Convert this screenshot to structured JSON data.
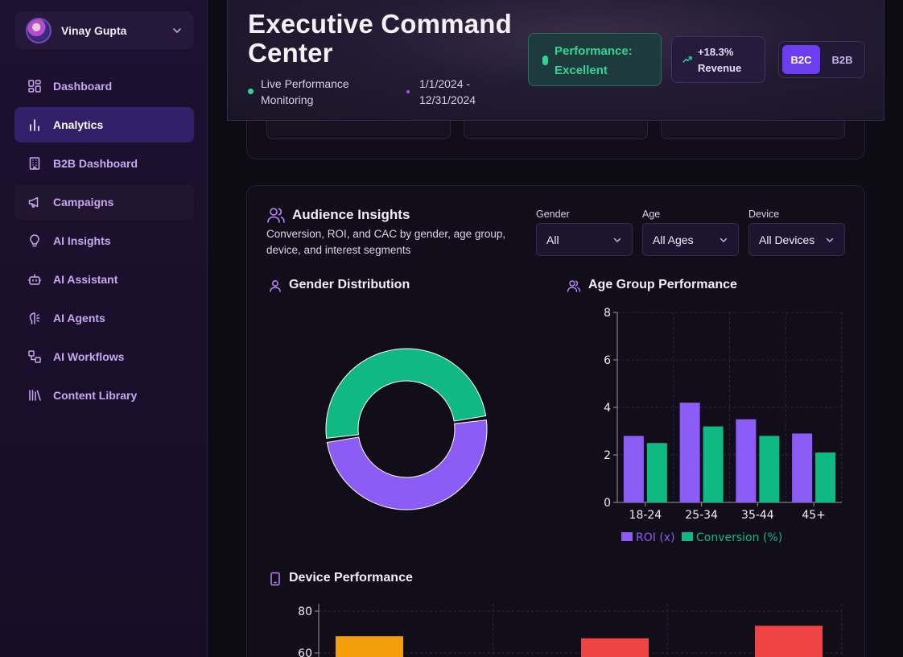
{
  "user": {
    "name": "Vinay Gupta"
  },
  "sidebar": {
    "items": [
      {
        "label": "Dashboard",
        "icon": "dashboard-icon"
      },
      {
        "label": "Analytics",
        "icon": "bar-chart-icon",
        "active": true
      },
      {
        "label": "B2B Dashboard",
        "icon": "building-icon"
      },
      {
        "label": "Campaigns",
        "icon": "megaphone-icon"
      },
      {
        "label": "AI Insights",
        "icon": "lightbulb-icon"
      },
      {
        "label": "AI Assistant",
        "icon": "bot-icon"
      },
      {
        "label": "AI Agents",
        "icon": "brain-icon"
      },
      {
        "label": "AI Workflows",
        "icon": "workflow-icon"
      },
      {
        "label": "Content Library",
        "icon": "library-icon"
      }
    ]
  },
  "header": {
    "title": "Executive Command Center",
    "status": "Live Performance Monitoring",
    "date_range": "1/1/2024 - 12/31/2024",
    "performance_badge": "Performance: Excellent",
    "revenue_badge": "+18.3% Revenue",
    "segments": [
      "B2C",
      "B2B"
    ],
    "active_segment": "B2C"
  },
  "audience": {
    "title": "Audience Insights",
    "description": "Conversion, ROI, and CAC by gender, age group, device, and interest segments",
    "filters": [
      {
        "label": "Gender",
        "value": "All"
      },
      {
        "label": "Age",
        "value": "All Ages"
      },
      {
        "label": "Device",
        "value": "All Devices"
      }
    ],
    "gender_title": "Gender Distribution",
    "age_title": "Age Group Performance",
    "device_title": "Device Performance"
  },
  "colors": {
    "purple": "#8b5cf6",
    "green": "#10b981",
    "orange": "#f59e0b",
    "red": "#ef4444",
    "accent": "#6d3df0"
  },
  "chart_data": [
    {
      "type": "pie",
      "title": "Gender Distribution",
      "values": [
        50,
        50
      ],
      "colors": [
        "#8b5cf6",
        "#10b981"
      ]
    },
    {
      "type": "bar",
      "title": "Age Group Performance",
      "categories": [
        "18-24",
        "25-34",
        "35-44",
        "45+"
      ],
      "series": [
        {
          "name": "ROI (x)",
          "values": [
            2.8,
            4.2,
            3.5,
            2.9
          ],
          "color": "#8b5cf6"
        },
        {
          "name": "Conversion (%)",
          "values": [
            2.5,
            3.2,
            2.8,
            2.1
          ],
          "color": "#10b981"
        }
      ],
      "yticks": [
        0,
        2,
        4,
        6,
        8
      ],
      "ylim": [
        0,
        8
      ],
      "legend": "bottom",
      "grid": true
    },
    {
      "type": "bar",
      "title": "Device Performance",
      "values": [
        68,
        67,
        73
      ],
      "colors": [
        "#f59e0b",
        "#ef4444",
        "#ef4444"
      ],
      "yticks": [
        60,
        80
      ],
      "ylim": [
        0,
        80
      ],
      "grid": true
    }
  ]
}
